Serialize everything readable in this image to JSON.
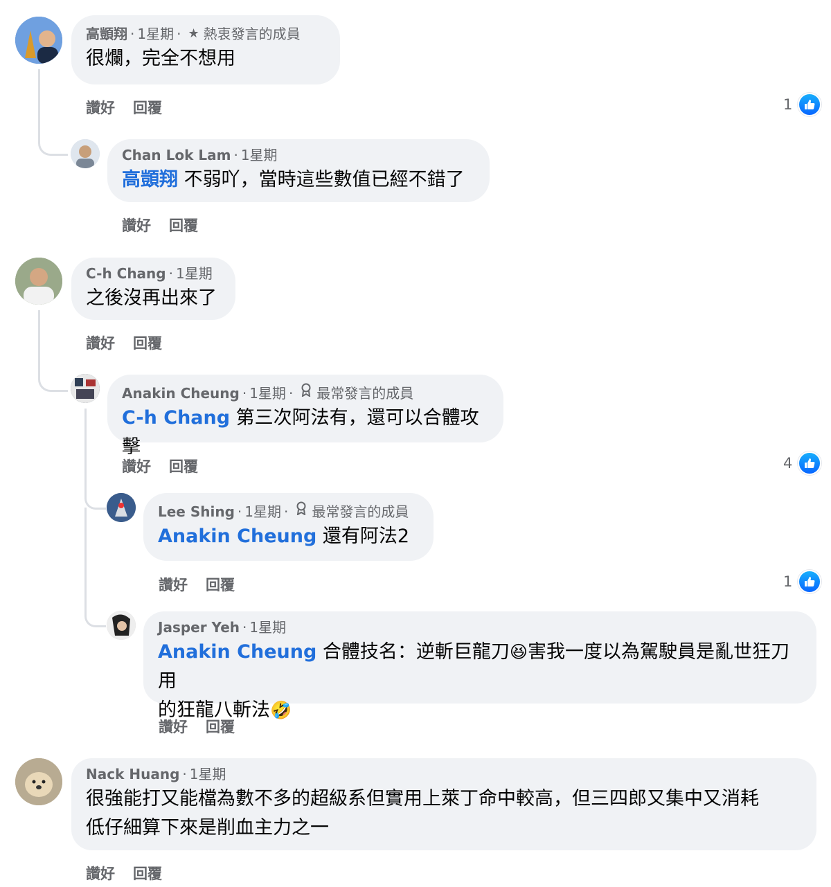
{
  "labels": {
    "like": "讚好",
    "reply": "回覆"
  },
  "colors": {
    "mention": "#216fdb",
    "bubble": "#f0f2f5",
    "meta": "#65676b",
    "like_blue": "#0866ff"
  },
  "comments": [
    {
      "author": "高顗翔",
      "time": "1星期",
      "badge_icon": "star-icon",
      "badge": "熱衷發言的成員",
      "text": "很爛，完全不想用",
      "reactions": "1",
      "reaction_icon": "like-icon"
    },
    {
      "author": "Chan Lok Lam",
      "time": "1星期",
      "mention": "高顗翔",
      "text": "不弱吖，當時這些數值已經不錯了"
    },
    {
      "author": "C-h Chang",
      "time": "1星期",
      "text": "之後沒再出來了"
    },
    {
      "author": "Anakin Cheung",
      "time": "1星期",
      "badge_icon": "award-icon",
      "badge": "最常發言的成員",
      "mention": "C-h Chang",
      "text": "第三次阿法有，還可以合體攻擊",
      "reactions": "4",
      "reaction_icon": "like-icon"
    },
    {
      "author": "Lee Shing",
      "time": "1星期",
      "badge_icon": "award-icon",
      "badge": "最常發言的成員",
      "mention": "Anakin Cheung",
      "text": "還有阿法2",
      "reactions": "1",
      "reaction_icon": "like-icon"
    },
    {
      "author": "Jasper Yeh",
      "time": "1星期",
      "mention": "Anakin Cheung",
      "text_a": "合體技名：逆斬巨龍刀",
      "emoji_a": "😆",
      "text_b": "害我一度以為駕駛員是亂世狂刀用",
      "text_c": "的狂龍八斬法",
      "emoji_b": "🤣"
    },
    {
      "author": "Nack Huang",
      "time": "1星期",
      "text_a": "很強能打又能檔為數不多的超級系但實用上萊丁命中較高，但三四郎又集中又消耗",
      "text_b": "低仔細算下來是削血主力之一"
    }
  ]
}
